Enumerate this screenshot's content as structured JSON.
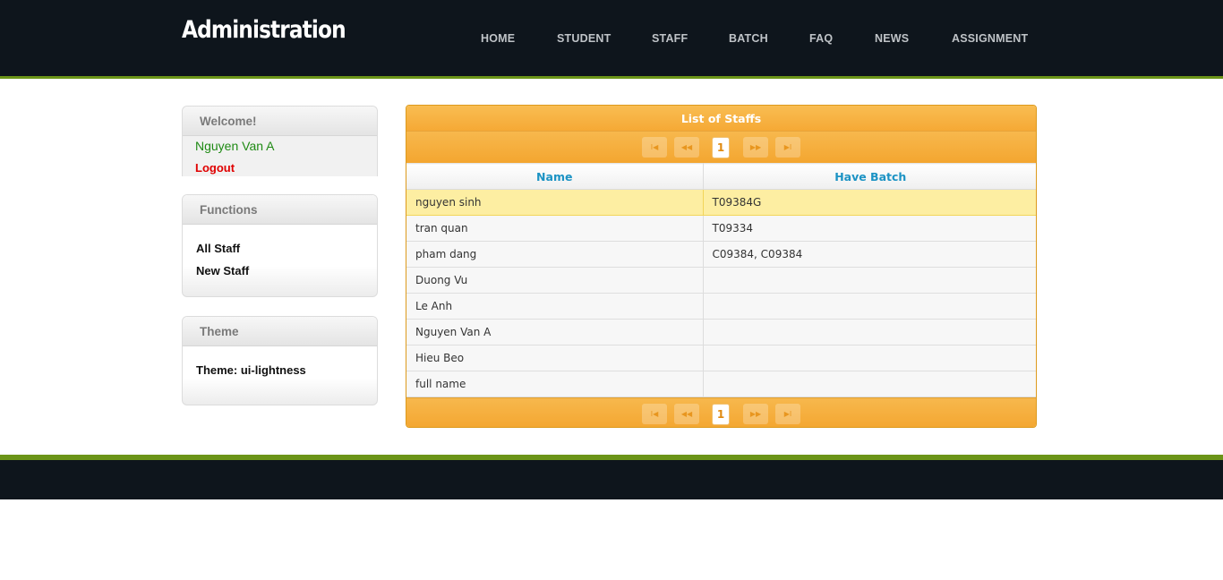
{
  "header": {
    "title": "Administration",
    "nav": [
      "HOME",
      "STUDENT",
      "STAFF",
      "BATCH",
      "FAQ",
      "NEWS",
      "ASSIGNMENT"
    ]
  },
  "sidebar": {
    "welcome": {
      "heading": "Welcome!",
      "user": "Nguyen Van A",
      "logout": "Logout"
    },
    "functions": {
      "heading": "Functions",
      "items": [
        "All Staff",
        "New Staff"
      ]
    },
    "theme": {
      "heading": "Theme",
      "text": "Theme: ui-lightness"
    }
  },
  "grid": {
    "caption": "List of Staffs",
    "pager": {
      "first": "I◀",
      "prev": "◀◀",
      "page": "1",
      "next": "▶▶",
      "last": "▶I"
    },
    "columns": [
      "Name",
      "Have Batch"
    ],
    "rows": [
      [
        "nguyen sinh",
        "T09384G"
      ],
      [
        "tran quan",
        "T09334"
      ],
      [
        "pham dang",
        "C09384, C09384"
      ],
      [
        "Duong Vu",
        ""
      ],
      [
        "Le Anh",
        ""
      ],
      [
        "Nguyen Van A",
        ""
      ],
      [
        "Hieu Beo",
        ""
      ],
      [
        "full name",
        ""
      ]
    ],
    "selected_row": 0
  },
  "colors": {
    "accent": "#6b9418",
    "header_bg": "#0e151c",
    "grid_header": "#f5a935",
    "selected_row": "#fdeea2",
    "column_header_text": "#1c93c4"
  }
}
